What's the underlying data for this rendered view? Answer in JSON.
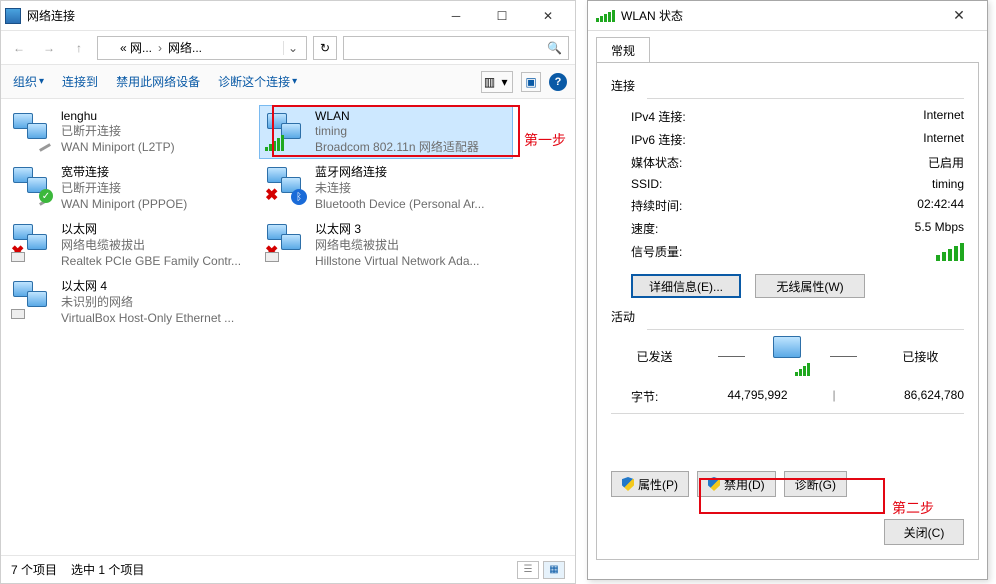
{
  "explorer": {
    "title": "网络连接",
    "breadcrumb": {
      "c1": "« 网...",
      "c2": "网络..."
    },
    "cmdbar": {
      "organize": "组织",
      "connect_to": "连接到",
      "disable_device": "禁用此网络设备",
      "diagnose": "诊断这个连接"
    },
    "items": [
      {
        "name": "lenghu",
        "l2": "已断开连接",
        "l3": "WAN Miniport (L2TP)"
      },
      {
        "name": "WLAN",
        "l2": "timing",
        "l3": "Broadcom 802.11n 网络适配器"
      },
      {
        "name": "宽带连接",
        "l2": "已断开连接",
        "l3": "WAN Miniport (PPPOE)"
      },
      {
        "name": "蓝牙网络连接",
        "l2": "未连接",
        "l3": "Bluetooth Device (Personal Ar..."
      },
      {
        "name": "以太网",
        "l2": "网络电缆被拔出",
        "l3": "Realtek PCIe GBE Family Contr..."
      },
      {
        "name": "以太网 3",
        "l2": "网络电缆被拔出",
        "l3": "Hillstone Virtual Network Ada..."
      },
      {
        "name": "以太网 4",
        "l2": "未识别的网络",
        "l3": "VirtualBox Host-Only Ethernet ..."
      }
    ],
    "status": {
      "count": "7 个项目",
      "selected": "选中 1 个项目"
    }
  },
  "step1_label": "第一步",
  "step2_label": "第二步",
  "dlg": {
    "title": "WLAN 状态",
    "tab": "常规",
    "section_conn": "连接",
    "kv": {
      "ipv4_k": "IPv4 连接:",
      "ipv4_v": "Internet",
      "ipv6_k": "IPv6 连接:",
      "ipv6_v": "Internet",
      "media_k": "媒体状态:",
      "media_v": "已启用",
      "ssid_k": "SSID:",
      "ssid_v": "timing",
      "dur_k": "持续时间:",
      "dur_v": "02:42:44",
      "spd_k": "速度:",
      "spd_v": "5.5 Mbps",
      "sig_k": "信号质量:"
    },
    "btn_detail": "详细信息(E)...",
    "btn_wprops": "无线属性(W)",
    "section_activity": "活动",
    "sent": "已发送",
    "recv": "已接收",
    "bytes_k": "字节:",
    "bytes_sent": "44,795,992",
    "bytes_recv": "86,624,780",
    "btn_props": "属性(P)",
    "btn_disable": "禁用(D)",
    "btn_diag": "诊断(G)",
    "btn_close": "关闭(C)"
  }
}
